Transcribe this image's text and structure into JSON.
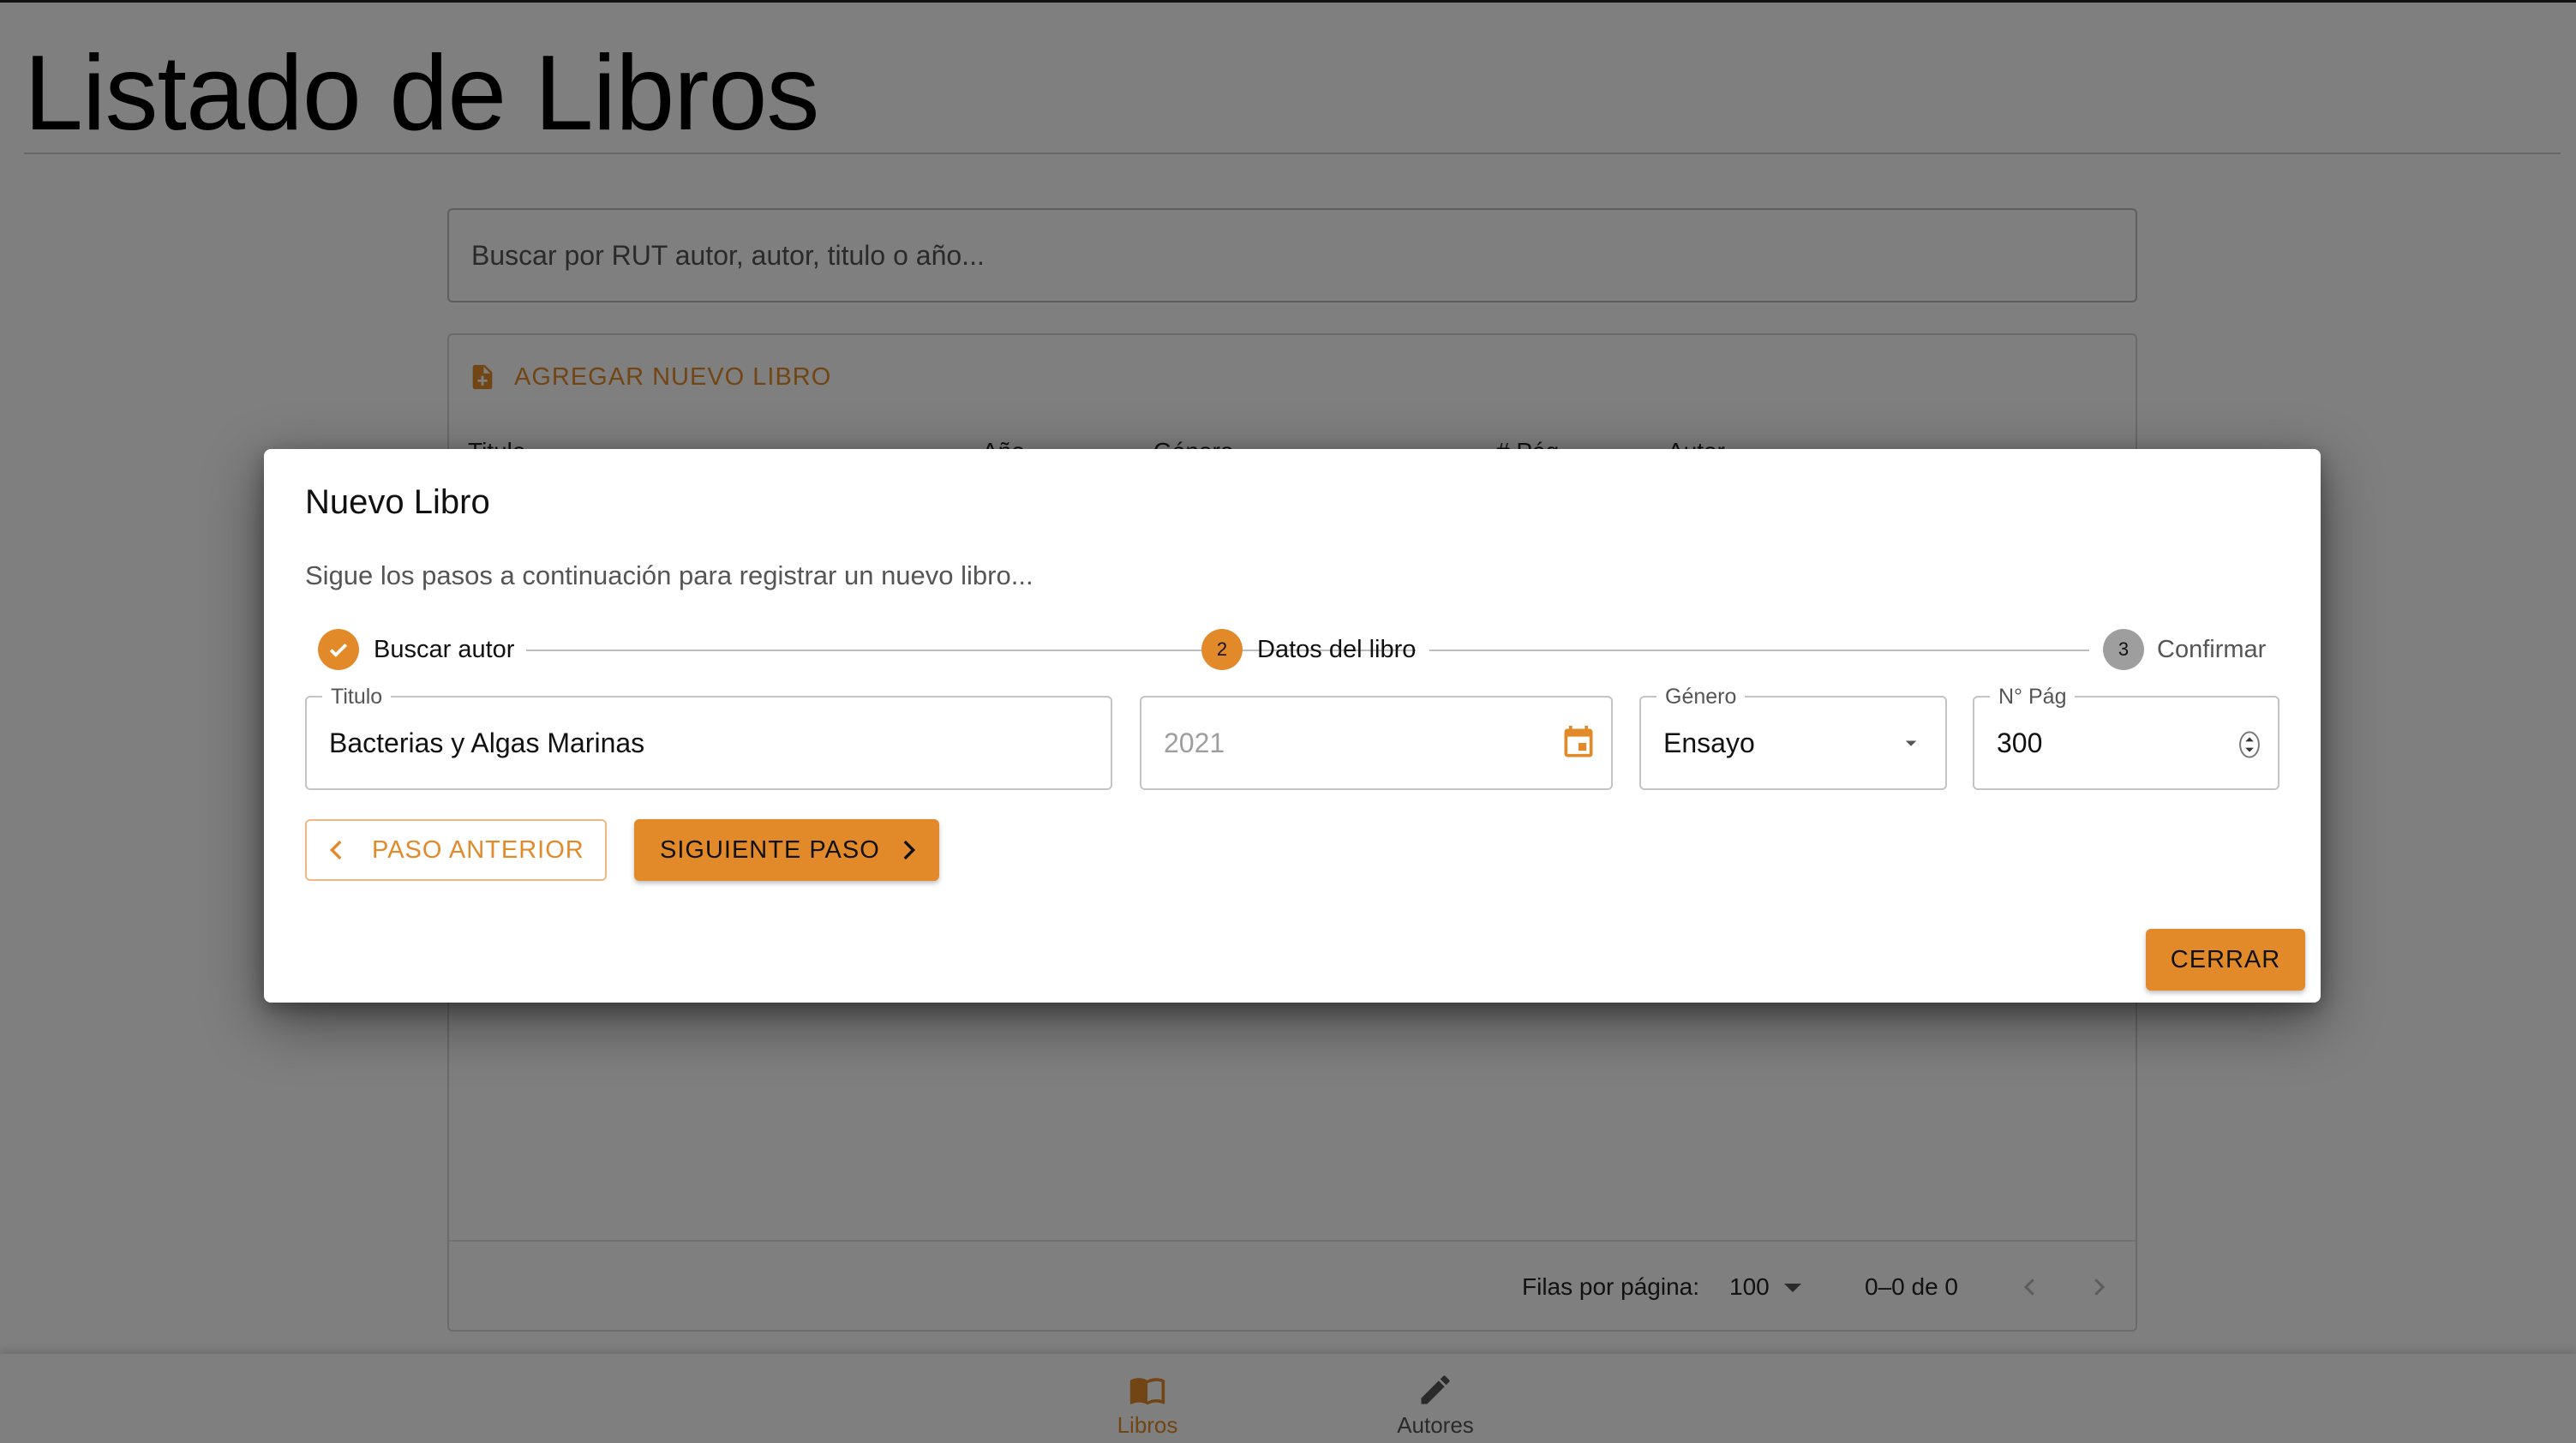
{
  "page": {
    "title": "Listado de Libros"
  },
  "search": {
    "placeholder": "Buscar por RUT autor, autor, titulo o año..."
  },
  "table": {
    "add_button_label": "AGREGAR NUEVO LIBRO",
    "columns": [
      "Titulo",
      "Año",
      "Género",
      "# Pág",
      "Autor"
    ],
    "footer": {
      "rows_per_page_label": "Filas por página:",
      "rows_per_page_value": "100",
      "range_text": "0–0 de 0"
    }
  },
  "bottom_nav": {
    "items": [
      {
        "label": "Libros",
        "icon": "open-book-icon",
        "active": true
      },
      {
        "label": "Autores",
        "icon": "edit-pen-icon",
        "active": false
      }
    ]
  },
  "dialog": {
    "title": "Nuevo Libro",
    "description": "Sigue los pasos a continuación para registrar un nuevo libro...",
    "steps": [
      {
        "number": "1",
        "label": "Buscar autor",
        "state": "completed"
      },
      {
        "number": "2",
        "label": "Datos del libro",
        "state": "active"
      },
      {
        "number": "3",
        "label": "Confirmar",
        "state": "pending"
      }
    ],
    "fields": {
      "titulo": {
        "label": "Titulo",
        "value": "Bacterias y Algas Marinas"
      },
      "anio": {
        "placeholder": "2021"
      },
      "genero": {
        "label": "Género",
        "value": "Ensayo"
      },
      "paginas": {
        "label": "N° Pág",
        "value": "300"
      }
    },
    "buttons": {
      "previous": "PASO ANTERIOR",
      "next": "SIGUIENTE PASO",
      "close": "CERRAR"
    }
  },
  "colors": {
    "accent": "#e28a29",
    "accent_light": "#efb882",
    "inactive_step": "#9e9e9e",
    "overlay": "rgba(0,0,0,0.5)"
  }
}
